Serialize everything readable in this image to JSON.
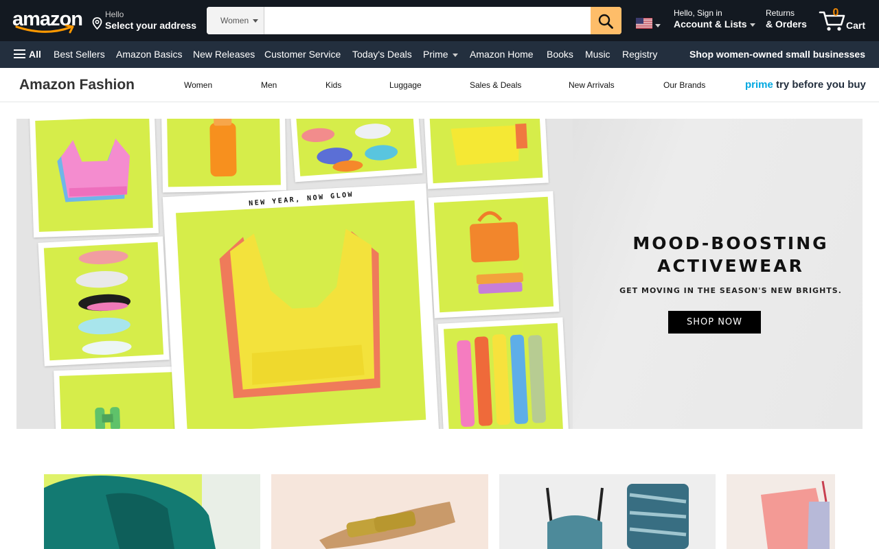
{
  "header": {
    "logo_text": "amazon",
    "deliver_line1": "Hello",
    "deliver_line2": "Select your address",
    "search_category": "Women",
    "search_placeholder": "",
    "account_line1": "Hello, Sign in",
    "account_line2": "Account & Lists",
    "returns_line1": "Returns",
    "returns_line2": "& Orders",
    "cart_count": "0",
    "cart_label": "Cart"
  },
  "subnav": {
    "all_label": "All",
    "items": [
      "Best Sellers",
      "Amazon Basics",
      "New Releases",
      "Customer Service",
      "Today's Deals",
      "Prime",
      "Amazon Home",
      "Books",
      "Music",
      "Registry"
    ],
    "promo": "Shop women-owned small businesses"
  },
  "fashion_nav": {
    "brand": "Amazon Fashion",
    "items": [
      "Women",
      "Men",
      "Kids",
      "Luggage",
      "Sales & Deals",
      "New Arrivals",
      "Our Brands"
    ],
    "prime_word": "prime",
    "prime_rest": " try before you buy"
  },
  "hero": {
    "tagline": "NEW YEAR, NOW GLOW",
    "title_line1": "MOOD-BOOSTING",
    "title_line2": "ACTIVEWEAR",
    "subtitle": "GET MOVING IN THE SEASON'S NEW BRIGHTS.",
    "cta": "SHOP NOW"
  },
  "colors": {
    "nav_dark": "#131921",
    "subnav": "#232f3e",
    "search_button": "#febd69",
    "cart_count": "#f08804",
    "prime_blue": "#00a8e1",
    "lime": "#d6ed4a"
  }
}
